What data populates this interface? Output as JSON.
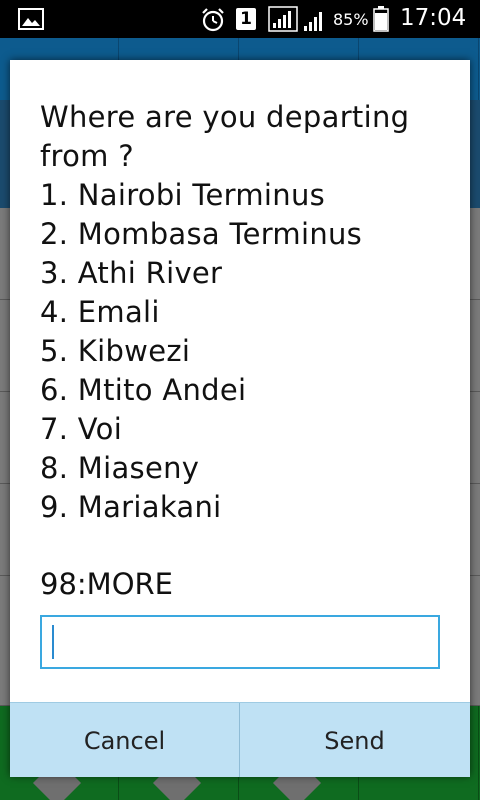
{
  "status_bar": {
    "sim_slot": "1",
    "battery_percent": "85%",
    "time": "17:04",
    "icons": [
      "gallery-icon",
      "alarm-icon",
      "signal-icon",
      "signal-icon",
      "battery-icon"
    ]
  },
  "dialog": {
    "message_lines": [
      "Where are you departing",
      "from ?",
      "1. Nairobi Terminus",
      "2. Mombasa Terminus",
      "3. Athi River",
      "4. Emali",
      "5. Kibwezi",
      "6. Mtito Andei",
      "7. Voi",
      "8. Miaseny",
      "9. Mariakani"
    ],
    "more_option": "98:MORE",
    "input_value": "",
    "cancel_label": "Cancel",
    "send_label": "Send"
  },
  "colors": {
    "accent": "#3aa8e0",
    "button_bg": "#bfe1f4"
  }
}
